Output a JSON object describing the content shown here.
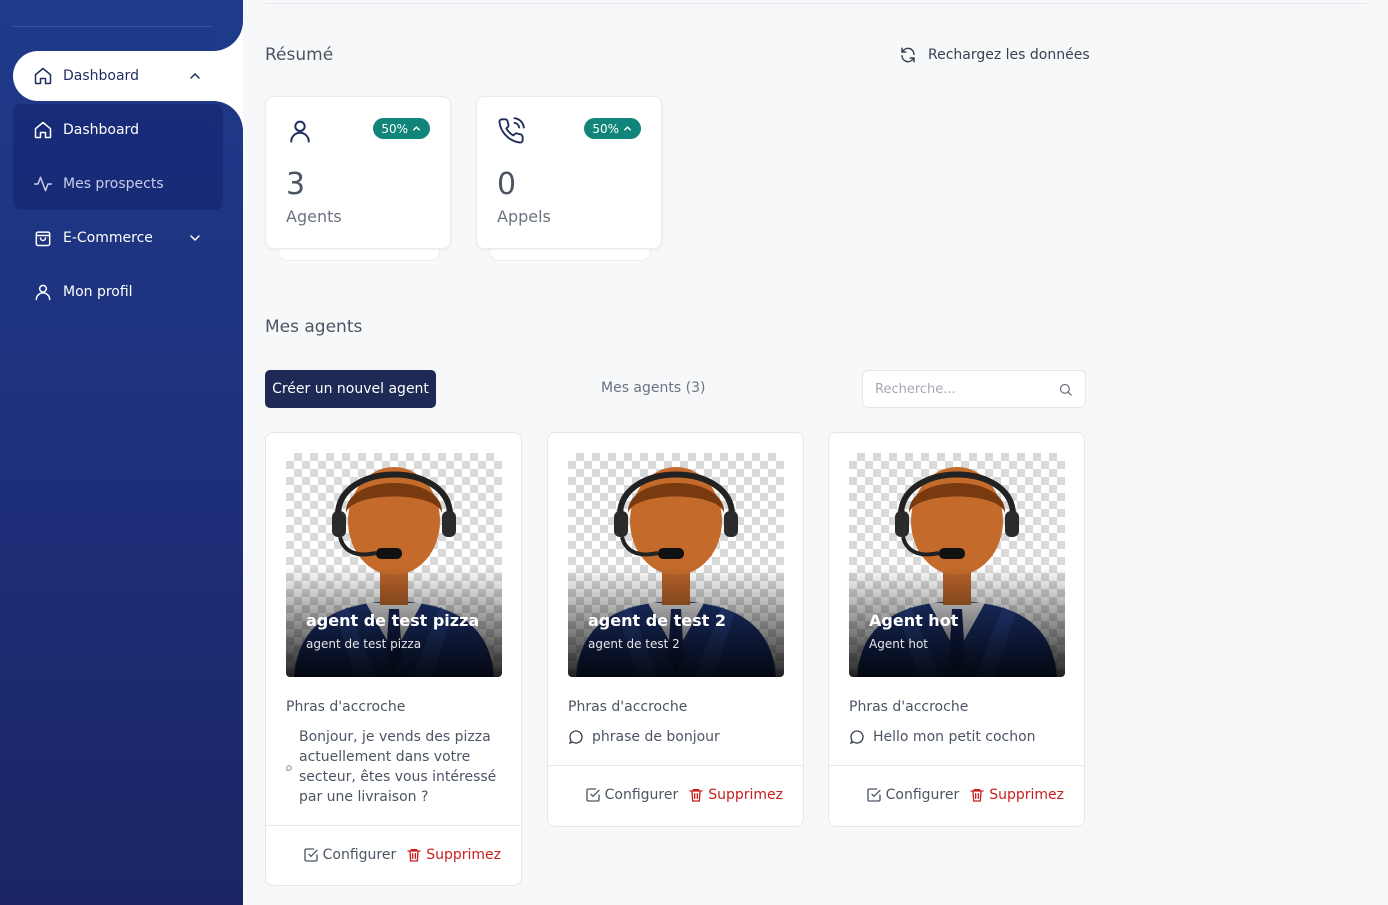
{
  "sidebar": {
    "items": [
      {
        "label": "Dashboard",
        "icon": "home-icon"
      },
      {
        "label": "Dashboard",
        "icon": "home-icon"
      },
      {
        "label": "Mes prospects",
        "icon": "activity-icon"
      },
      {
        "label": "E-Commerce",
        "icon": "shopping-bag-icon"
      },
      {
        "label": "Mon profil",
        "icon": "user-icon"
      }
    ]
  },
  "summary": {
    "title": "Résumé",
    "reload_label": "Rechargez les données",
    "stats": [
      {
        "value": "3",
        "label": "Agents",
        "badge": "50%",
        "icon": "user-icon"
      },
      {
        "value": "0",
        "label": "Appels",
        "badge": "50%",
        "icon": "phone-call-icon"
      }
    ]
  },
  "agents": {
    "title": "Mes agents",
    "create_label": "Créer un nouvel agent",
    "count_label": "Mes agents (3)",
    "search_placeholder": "Recherche...",
    "cards": [
      {
        "name": "agent de test pizza",
        "subtitle": "agent de test pizza",
        "hook_label": "Phras d'accroche",
        "hook": "Bonjour, je vends des pizza actuellement dans votre secteur, êtes vous intéressé par une livraison ?",
        "configure": "Configurer",
        "delete": "Supprimez"
      },
      {
        "name": "agent de test 2",
        "subtitle": "agent de test 2",
        "hook_label": "Phras d'accroche",
        "hook": "phrase de bonjour",
        "configure": "Configurer",
        "delete": "Supprimez"
      },
      {
        "name": "Agent hot",
        "subtitle": "Agent hot",
        "hook_label": "Phras d'accroche",
        "hook": "Hello mon petit cochon",
        "configure": "Configurer",
        "delete": "Supprimez"
      }
    ]
  },
  "colors": {
    "sidebar": "#1e3a8a",
    "badge": "#12857a",
    "primary_button": "#1e2955",
    "danger": "#c81e1e"
  }
}
